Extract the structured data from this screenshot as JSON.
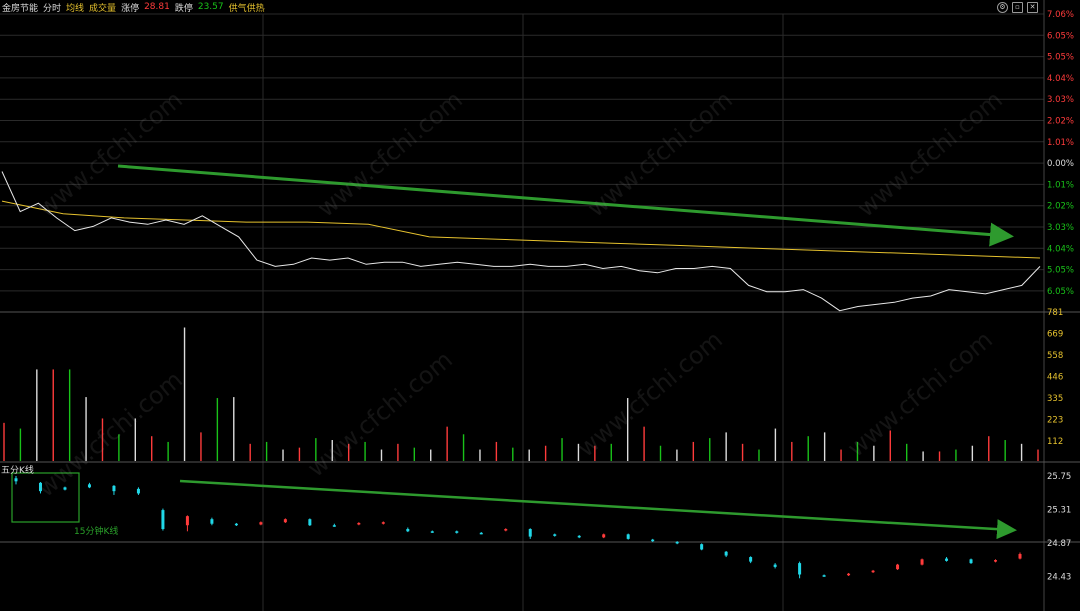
{
  "header": {
    "stock_name": "金房节能",
    "tabs": [
      "分时",
      "均线",
      "成交量"
    ],
    "limit_up_label": "涨停",
    "limit_up_value": "28.81",
    "limit_down_label": "跌停",
    "limit_down_value": "23.57",
    "sector": "供气供热"
  },
  "window_icons": [
    "settings-icon",
    "restore-icon",
    "close-icon"
  ],
  "watermark_text": "www.cfchi.com",
  "kline_panel": {
    "title": "五分K线",
    "annotation": "15分钟K线"
  },
  "colors": {
    "up": "#ff3b3b",
    "down": "#19c219",
    "price_line": "#e8e8e8",
    "avg_line": "#e6c22e",
    "grid": "#2a2a2a",
    "trend_arrow": "#2e9a2e",
    "candle_down": "#20d8e8"
  },
  "chart_data": {
    "type": "line",
    "price_axis_pct_labels": [
      "7.06%",
      "6.05%",
      "5.05%",
      "4.04%",
      "3.03%",
      "2.02%",
      "1.01%",
      "0.00%",
      "1.01%",
      "2.02%",
      "3.03%",
      "4.04%",
      "5.05%",
      "6.05%"
    ],
    "volume_axis_labels": [
      "781",
      "669",
      "558",
      "446",
      "335",
      "223",
      "112"
    ],
    "kline_axis_labels": [
      "25.75",
      "25.31",
      "24.87",
      "24.43"
    ],
    "price_pct_series": [
      -0.4,
      -2.3,
      -1.9,
      -2.6,
      -3.2,
      -3.0,
      -2.6,
      -2.8,
      -2.9,
      -2.7,
      -2.9,
      -2.5,
      -3.0,
      -3.5,
      -4.6,
      -4.9,
      -4.8,
      -4.5,
      -4.6,
      -4.5,
      -4.8,
      -4.7,
      -4.7,
      -4.9,
      -4.8,
      -4.7,
      -4.8,
      -4.9,
      -4.9,
      -4.8,
      -4.9,
      -4.9,
      -4.8,
      -5.0,
      -4.9,
      -5.1,
      -5.2,
      -5.0,
      -5.0,
      -4.9,
      -5.0,
      -5.8,
      -6.1,
      -6.1,
      -6.0,
      -6.4,
      -7.0,
      -6.8,
      -6.7,
      -6.6,
      -6.4,
      -6.3,
      -6.0,
      -6.1,
      -6.2,
      -6.0,
      -5.8,
      -4.9
    ],
    "avg_pct_series": [
      -1.8,
      -2.4,
      -2.6,
      -2.7,
      -2.8,
      -2.8,
      -2.9,
      -3.5,
      -3.6,
      -3.7,
      -3.8,
      -3.9,
      -4.0,
      -4.1,
      -4.2,
      -4.3,
      -4.4,
      -4.5
    ],
    "volume_series": [
      200,
      170,
      480,
      480,
      480,
      335,
      223,
      140,
      223,
      130,
      100,
      700,
      150,
      330,
      335,
      90,
      100,
      60,
      70,
      120,
      110,
      90,
      100,
      60,
      90,
      70,
      60,
      180,
      140,
      60,
      100,
      70,
      60,
      80,
      120,
      90,
      80,
      90,
      330,
      180,
      80,
      60,
      100,
      120,
      150,
      90,
      60,
      170,
      100,
      130,
      150,
      60,
      100,
      80,
      160,
      90,
      50,
      50,
      60,
      80,
      130,
      110,
      90,
      60
    ],
    "kline_candles": [
      {
        "o": 25.72,
        "c": 25.68,
        "h": 25.75,
        "l": 25.64
      },
      {
        "o": 25.66,
        "c": 25.55,
        "h": 25.67,
        "l": 25.52
      },
      {
        "o": 25.6,
        "c": 25.57,
        "h": 25.61,
        "l": 25.56
      },
      {
        "o": 25.64,
        "c": 25.6,
        "h": 25.66,
        "l": 25.59
      },
      {
        "o": 25.62,
        "c": 25.55,
        "h": 25.63,
        "l": 25.5
      },
      {
        "o": 25.58,
        "c": 25.52,
        "h": 25.6,
        "l": 25.5
      },
      {
        "o": 25.3,
        "c": 25.05,
        "h": 25.32,
        "l": 25.03
      },
      {
        "o": 25.1,
        "c": 25.22,
        "h": 25.23,
        "l": 25.02
      },
      {
        "o": 25.18,
        "c": 25.12,
        "h": 25.2,
        "l": 25.1
      },
      {
        "o": 25.12,
        "c": 25.1,
        "h": 25.13,
        "l": 25.09
      },
      {
        "o": 25.11,
        "c": 25.14,
        "h": 25.15,
        "l": 25.1
      },
      {
        "o": 25.14,
        "c": 25.18,
        "h": 25.19,
        "l": 25.13
      },
      {
        "o": 25.18,
        "c": 25.1,
        "h": 25.19,
        "l": 25.09
      },
      {
        "o": 25.1,
        "c": 25.09,
        "h": 25.12,
        "l": 25.08
      },
      {
        "o": 25.11,
        "c": 25.13,
        "h": 25.14,
        "l": 25.1
      },
      {
        "o": 25.12,
        "c": 25.14,
        "h": 25.15,
        "l": 25.11
      },
      {
        "o": 25.05,
        "c": 25.02,
        "h": 25.07,
        "l": 25.01
      },
      {
        "o": 25.02,
        "c": 25.01,
        "h": 25.03,
        "l": 25.0
      },
      {
        "o": 25.02,
        "c": 25.0,
        "h": 25.03,
        "l": 24.99
      },
      {
        "o": 25.0,
        "c": 24.99,
        "h": 25.01,
        "l": 24.98
      },
      {
        "o": 25.03,
        "c": 25.05,
        "h": 25.06,
        "l": 25.02
      },
      {
        "o": 25.05,
        "c": 24.95,
        "h": 25.06,
        "l": 24.92
      },
      {
        "o": 24.98,
        "c": 24.96,
        "h": 24.99,
        "l": 24.95
      },
      {
        "o": 24.96,
        "c": 24.94,
        "h": 24.97,
        "l": 24.93
      },
      {
        "o": 24.94,
        "c": 24.98,
        "h": 24.99,
        "l": 24.93
      },
      {
        "o": 24.98,
        "c": 24.92,
        "h": 24.99,
        "l": 24.91
      },
      {
        "o": 24.91,
        "c": 24.89,
        "h": 24.92,
        "l": 24.88
      },
      {
        "o": 24.88,
        "c": 24.86,
        "h": 24.89,
        "l": 24.85
      },
      {
        "o": 24.85,
        "c": 24.78,
        "h": 24.86,
        "l": 24.77
      },
      {
        "o": 24.75,
        "c": 24.7,
        "h": 24.76,
        "l": 24.68
      },
      {
        "o": 24.68,
        "c": 24.62,
        "h": 24.69,
        "l": 24.6
      },
      {
        "o": 24.58,
        "c": 24.55,
        "h": 24.6,
        "l": 24.53
      },
      {
        "o": 24.6,
        "c": 24.45,
        "h": 24.62,
        "l": 24.4
      },
      {
        "o": 24.44,
        "c": 24.43,
        "h": 24.45,
        "l": 24.42
      },
      {
        "o": 24.44,
        "c": 24.46,
        "h": 24.47,
        "l": 24.43
      },
      {
        "o": 24.48,
        "c": 24.5,
        "h": 24.51,
        "l": 24.47
      },
      {
        "o": 24.52,
        "c": 24.58,
        "h": 24.59,
        "l": 24.51
      },
      {
        "o": 24.58,
        "c": 24.65,
        "h": 24.66,
        "l": 24.57
      },
      {
        "o": 24.66,
        "c": 24.63,
        "h": 24.68,
        "l": 24.62
      },
      {
        "o": 24.65,
        "c": 24.6,
        "h": 24.66,
        "l": 24.59
      },
      {
        "o": 24.62,
        "c": 24.64,
        "h": 24.65,
        "l": 24.61
      },
      {
        "o": 24.66,
        "c": 24.72,
        "h": 24.74,
        "l": 24.65
      }
    ]
  }
}
